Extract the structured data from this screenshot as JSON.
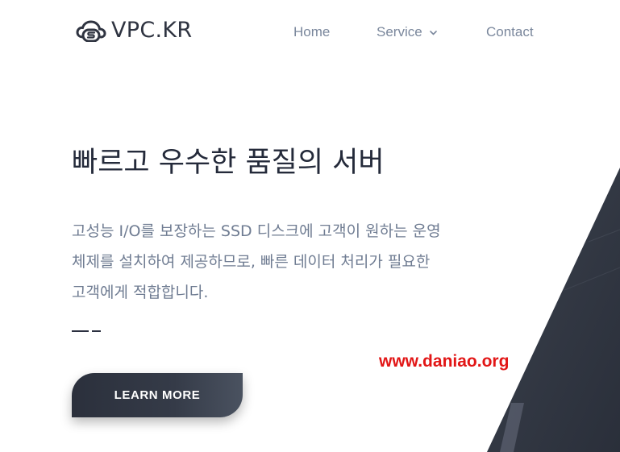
{
  "brand": {
    "name": "VPC.KR",
    "icon": "cloud-s-logo"
  },
  "nav": {
    "home": "Home",
    "service": "Service",
    "contact": "Contact"
  },
  "hero": {
    "title": "빠르고 우수한 품질의 서버",
    "description_lines": [
      "고성능 I/O를 보장하는 SSD 디스크에 고객이 원하는 운영",
      "체제를 설치하여 제공하므로, 빠른 데이터 처리가 필요한",
      "고객에게 적합합니다."
    ],
    "cta": "LEARN MORE"
  },
  "watermark": "www.daniao.org",
  "colors": {
    "brand_dark": "#2f3441",
    "nav_text": "#7a879c",
    "title": "#242a3a",
    "body_text": "#6f7c92",
    "button_bg": "#333946",
    "watermark": "#e21616",
    "accent_shape": "#2f3540"
  }
}
